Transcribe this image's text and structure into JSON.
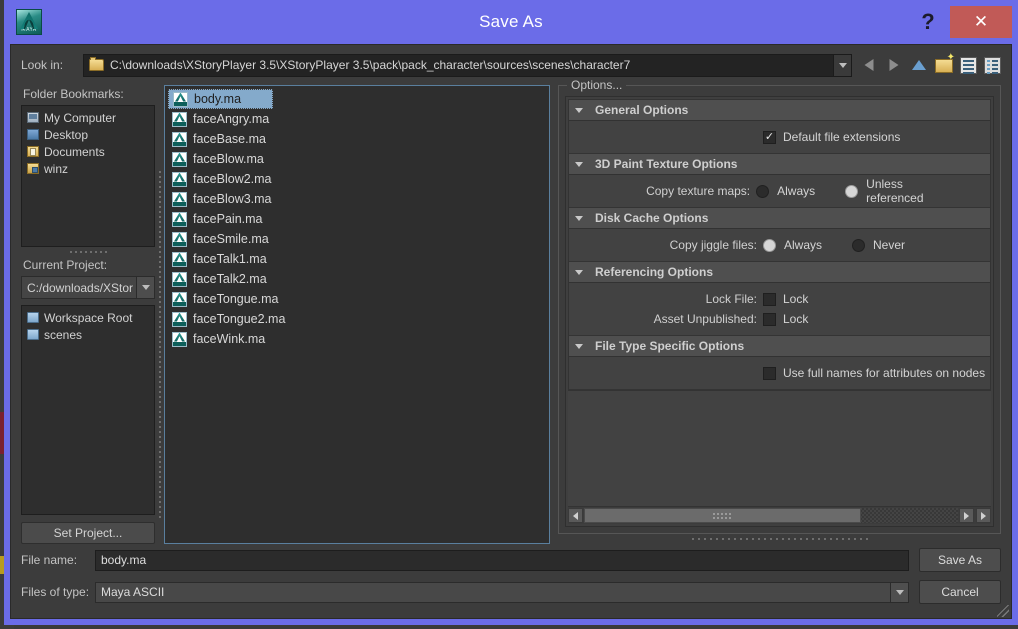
{
  "window": {
    "title": "Save As",
    "app_icon_name": "maya-app-icon",
    "app_icon_mark": "MAYA",
    "help_label": "?",
    "close_label": "✕",
    "accent_titlebar": "#6b6ce8",
    "accent_close": "#c15a57"
  },
  "lookin": {
    "label": "Look in:",
    "path": "C:\\downloads\\XStoryPlayer 3.5\\XStoryPlayer 3.5\\pack\\pack_character\\sources\\scenes\\character7",
    "nav": [
      {
        "name": "back-arrow-icon",
        "title": "Back"
      },
      {
        "name": "forward-arrow-icon",
        "title": "Forward"
      },
      {
        "name": "up-arrow-icon",
        "title": "Up one level"
      },
      {
        "name": "new-folder-icon",
        "title": "New folder"
      },
      {
        "name": "list-view-icon",
        "title": "List view"
      },
      {
        "name": "detail-view-icon",
        "title": "Detail view"
      }
    ]
  },
  "bookmarks": {
    "label": "Folder Bookmarks:",
    "items": [
      {
        "label": "My Computer",
        "icon": "computer-icon"
      },
      {
        "label": "Desktop",
        "icon": "desktop-icon"
      },
      {
        "label": "Documents",
        "icon": "documents-folder-icon"
      },
      {
        "label": "winz",
        "icon": "winz-folder-icon"
      }
    ]
  },
  "project": {
    "label": "Current Project:",
    "value": "C:/downloads/XStor",
    "workspace": [
      {
        "label": "Workspace Root",
        "icon": "folder-icon"
      },
      {
        "label": "scenes",
        "icon": "folder-icon"
      }
    ],
    "set_project_label": "Set Project..."
  },
  "files": {
    "selected": "body.ma",
    "items": [
      "body.ma",
      "faceAngry.ma",
      "faceBase.ma",
      "faceBlow.ma",
      "faceBlow2.ma",
      "faceBlow3.ma",
      "facePain.ma",
      "faceSmile.ma",
      "faceTalk1.ma",
      "faceTalk2.ma",
      "faceTongue.ma",
      "faceTongue2.ma",
      "faceWink.ma"
    ]
  },
  "options": {
    "group_title": "Options...",
    "frames": [
      {
        "title": "General Options",
        "rows": [
          {
            "kind": "checkbox",
            "label_left": "",
            "checkbox_label": "Default file extensions",
            "checked": true
          }
        ]
      },
      {
        "title": "3D Paint Texture Options",
        "rows": [
          {
            "kind": "radio",
            "label_left": "Copy texture maps:",
            "choices": [
              {
                "label": "Always",
                "selected": false
              },
              {
                "label": "Unless referenced",
                "selected": true
              }
            ]
          }
        ]
      },
      {
        "title": "Disk Cache Options",
        "rows": [
          {
            "kind": "radio",
            "label_left": "Copy jiggle files:",
            "choices": [
              {
                "label": "Always",
                "selected": true
              },
              {
                "label": "Never",
                "selected": false
              }
            ]
          }
        ]
      },
      {
        "title": "Referencing Options",
        "rows": [
          {
            "kind": "checkbox",
            "label_left": "Lock File:",
            "checkbox_label": "Lock",
            "checked": false
          },
          {
            "kind": "checkbox",
            "label_left": "Asset Unpublished:",
            "checkbox_label": "Lock",
            "checked": false
          }
        ]
      },
      {
        "title": "File Type Specific Options",
        "rows": [
          {
            "kind": "checkbox",
            "label_left": "",
            "checkbox_label": "Use full names for attributes on nodes",
            "checked": false
          }
        ]
      }
    ]
  },
  "footer": {
    "filename_label": "File name:",
    "filename_value": "body.ma",
    "filetype_label": "Files of type:",
    "filetype_value": "Maya ASCII",
    "save_label": "Save As",
    "cancel_label": "Cancel"
  }
}
